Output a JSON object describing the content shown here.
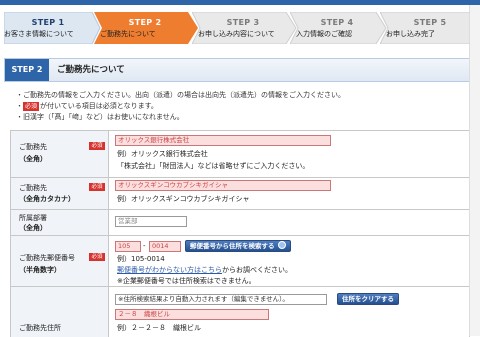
{
  "steps": [
    {
      "num": "STEP 1",
      "label": "お客さま情報について",
      "state": "done"
    },
    {
      "num": "STEP 2",
      "label": "ご勤務先について",
      "state": "current"
    },
    {
      "num": "STEP 3",
      "label": "お申し込み内容について",
      "state": "upcoming"
    },
    {
      "num": "STEP 4",
      "label": "入力情報のご確認",
      "state": "upcoming"
    },
    {
      "num": "STEP 5",
      "label": "お申し込み完了",
      "state": "upcoming"
    }
  ],
  "section": {
    "badge": "STEP 2",
    "title": "ご勤務先について"
  },
  "notes": {
    "n1": "ご勤務先の情報をご入力ください。出向（派遣）の場合は出向先（派遣先）の情報をご入力ください。",
    "n2_badge": "必須",
    "n2_text": "が付いている項目は必須となります。",
    "n3": "旧漢字（「髙」「﨑」など）はお使いになれません。"
  },
  "required_label": "必須",
  "form": {
    "company": {
      "label": "ご勤務先",
      "sublabel": "（全角）",
      "value": "オリックス銀行株式会社",
      "example": "例）オリックス銀行株式会社",
      "hint": "「株式会社」「財団法人」などは省略せずにご入力ください。"
    },
    "company_kana": {
      "label": "ご勤務先",
      "sublabel": "（全角カタカナ）",
      "value": "オリックスギンコウカブシキガイシャ",
      "example": "例）オリックスギンコウカブシキガイシャ"
    },
    "department": {
      "label": "所属部署",
      "sublabel": "（全角）",
      "placeholder": "営業部"
    },
    "postal": {
      "label": "ご勤務先郵便番号",
      "sublabel": "（半角数字）",
      "value1": "105",
      "separator": "-",
      "value2": "0014",
      "search_button": "郵便番号から住所を検索する",
      "example": "例）105-0014",
      "link": "郵便番号がわからない方はこちら",
      "link_suffix": "からお調べください。",
      "note": "※企業郵便番号では住所検索はできません。"
    },
    "address": {
      "label": "ご勤務先住所",
      "auto_text": "※住所検索結果より自動入力されます（編集できません）。",
      "clear_button": "住所をクリアする",
      "value": "２－８　織根ビル",
      "example": "例）２－２－８　織根ビル"
    }
  }
}
